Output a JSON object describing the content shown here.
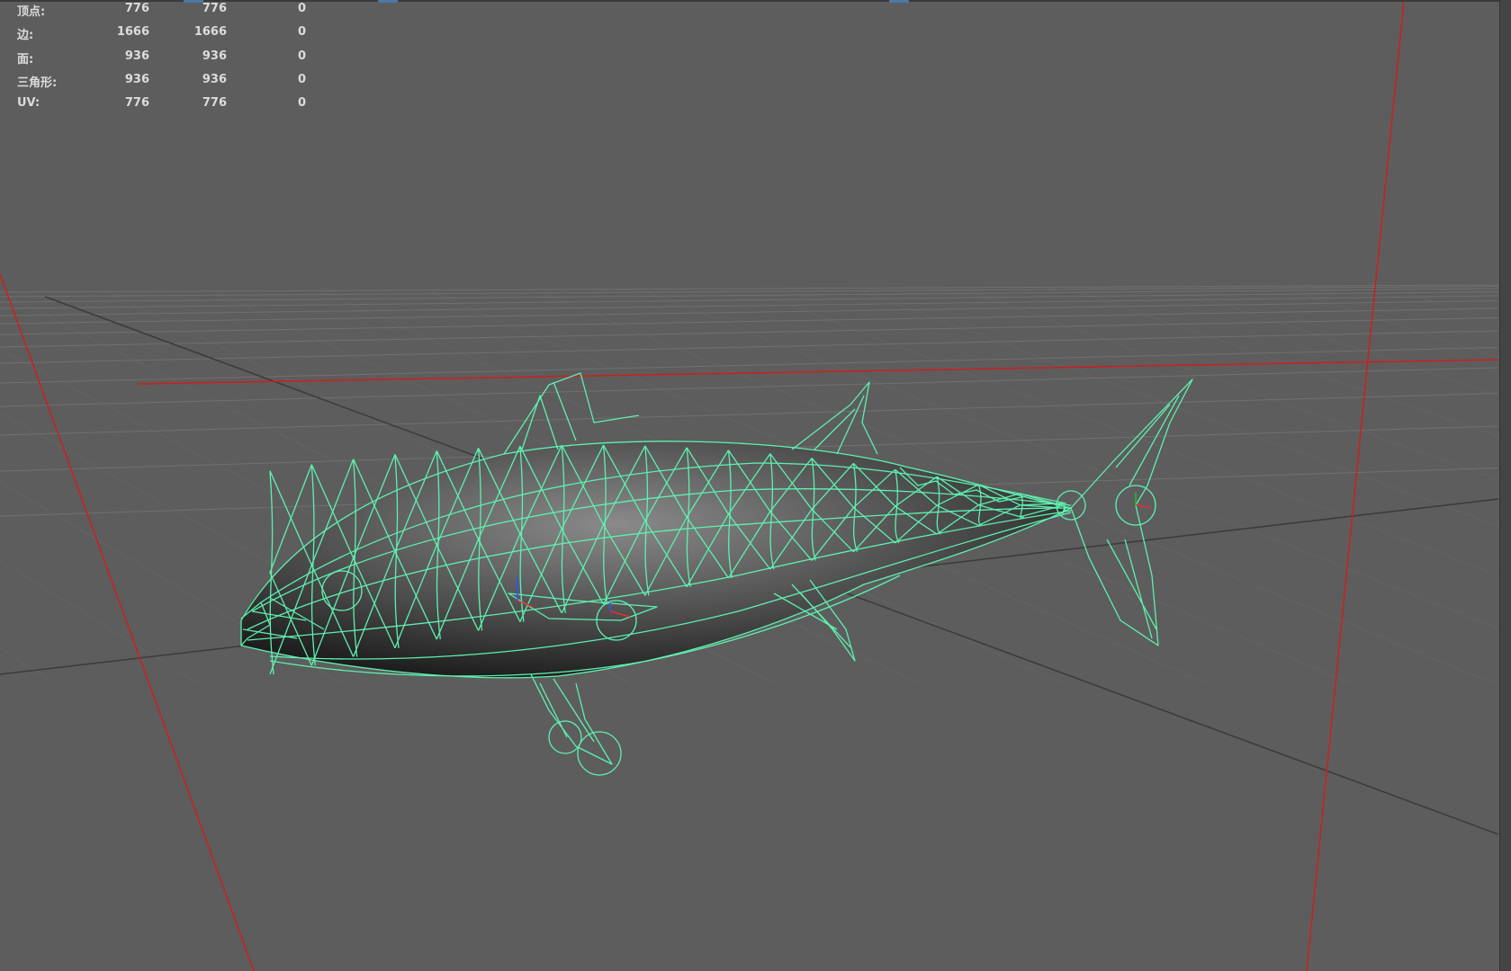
{
  "hud": {
    "rows": [
      {
        "label": "顶点:",
        "v1": "776",
        "v2": "776",
        "v3": "0"
      },
      {
        "label": "边:",
        "v1": "1666",
        "v2": "1666",
        "v3": "0"
      },
      {
        "label": "面:",
        "v1": "936",
        "v2": "936",
        "v3": "0"
      },
      {
        "label": "三角形:",
        "v1": "936",
        "v2": "936",
        "v3": "0"
      },
      {
        "label": "UV:",
        "v1": "776",
        "v2": "776",
        "v3": "0"
      }
    ]
  },
  "viewport": {
    "background": "#5d5d5d",
    "grid_color": "#6e6e6e",
    "axis_color": "#3c3c3c",
    "camera_line_color": "#cc1f1f",
    "wireframe_color": "#5ef0b0",
    "object": "fish-mesh"
  }
}
